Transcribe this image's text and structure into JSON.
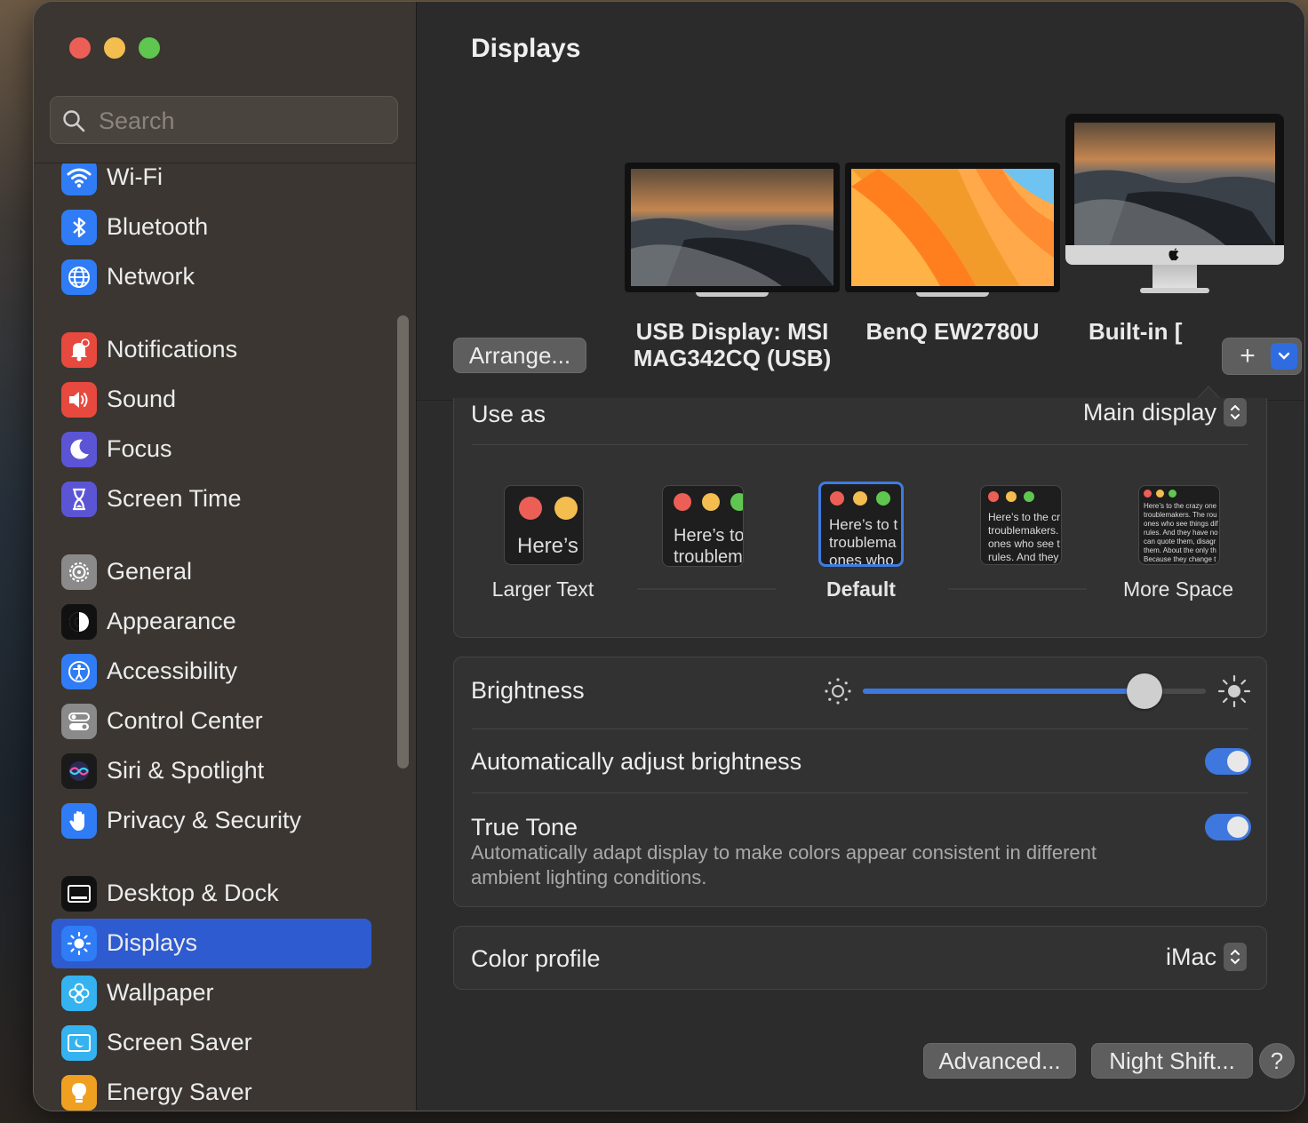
{
  "window": {
    "title": "Displays"
  },
  "search": {
    "placeholder": "Search"
  },
  "sidebar": {
    "items": [
      {
        "label": "Wi-Fi",
        "icon": "wifi-icon",
        "color": "#2f7cf6"
      },
      {
        "label": "Bluetooth",
        "icon": "bluetooth-icon",
        "color": "#2f7cf6"
      },
      {
        "label": "Network",
        "icon": "globe-icon",
        "color": "#2f7cf6"
      },
      {
        "label": "Notifications",
        "icon": "bell-icon",
        "color": "#e8493f"
      },
      {
        "label": "Sound",
        "icon": "speaker-icon",
        "color": "#e8493f"
      },
      {
        "label": "Focus",
        "icon": "moon-icon",
        "color": "#5b55d6"
      },
      {
        "label": "Screen Time",
        "icon": "hourglass-icon",
        "color": "#5b55d6"
      },
      {
        "label": "General",
        "icon": "gear-icon",
        "color": "#8a8a8a"
      },
      {
        "label": "Appearance",
        "icon": "appearance-icon",
        "color": "#111111"
      },
      {
        "label": "Accessibility",
        "icon": "accessibility-icon",
        "color": "#2f7cf6"
      },
      {
        "label": "Control Center",
        "icon": "control-center-icon",
        "color": "#8a8a8a"
      },
      {
        "label": "Siri & Spotlight",
        "icon": "siri-icon",
        "color": "#1a1a1a"
      },
      {
        "label": "Privacy & Security",
        "icon": "hand-icon",
        "color": "#2f7cf6"
      },
      {
        "label": "Desktop & Dock",
        "icon": "dock-icon",
        "color": "#111111"
      },
      {
        "label": "Displays",
        "icon": "sun-icon",
        "color": "#2f7cf6",
        "active": true
      },
      {
        "label": "Wallpaper",
        "icon": "flower-icon",
        "color": "#34b3f0"
      },
      {
        "label": "Screen Saver",
        "icon": "screen-saver-icon",
        "color": "#34b3f0"
      },
      {
        "label": "Energy Saver",
        "icon": "bulb-icon",
        "color": "#f0a020"
      }
    ]
  },
  "displays": {
    "arrange_label": "Arrange...",
    "monitors": [
      {
        "name_line1": "USB Display: MSI",
        "name_line2": "MAG342CQ (USB)",
        "icon": "monitor-icon"
      },
      {
        "name_line1": "BenQ EW2780U",
        "name_line2": "",
        "icon": "monitor-icon"
      },
      {
        "name_line1": "Built-in [",
        "name_line2": "",
        "icon": "imac-icon",
        "selected": true
      }
    ],
    "add_label": "+"
  },
  "use_as": {
    "label": "Use as",
    "value": "Main display"
  },
  "resolution": {
    "options": [
      {
        "label": "Larger Text",
        "preview": "Here’s"
      },
      {
        "label": "",
        "preview_line1": "Here’s to",
        "preview_line2": "troublem"
      },
      {
        "label": "Default",
        "preview_line1": "Here’s to t",
        "preview_line2": "troublema",
        "preview_line3": "ones who",
        "selected": true
      },
      {
        "label": "",
        "preview_lines": [
          "Here’s to the cr",
          "troublemakers.",
          "ones who see t",
          "rules. And they"
        ]
      },
      {
        "label": "More Space",
        "preview_lines": [
          "Here’s to the crazy one",
          "troublemakers. The rou",
          "ones who see things dif",
          "rules. And they have no",
          "can quote them, disagr",
          "them. About the only th",
          "Because they change t"
        ]
      }
    ]
  },
  "brightness": {
    "label": "Brightness",
    "value_percent": 82,
    "accent": "#3e77de"
  },
  "auto_brightness": {
    "label": "Automatically adjust brightness",
    "on": true
  },
  "true_tone": {
    "label": "True Tone",
    "description_line1": "Automatically adapt display to make colors appear consistent in different",
    "description_line2": "ambient lighting conditions.",
    "on": true
  },
  "color_profile": {
    "label": "Color profile",
    "value": "iMac"
  },
  "footer": {
    "advanced_label": "Advanced...",
    "night_shift_label": "Night Shift...",
    "help_label": "?"
  }
}
